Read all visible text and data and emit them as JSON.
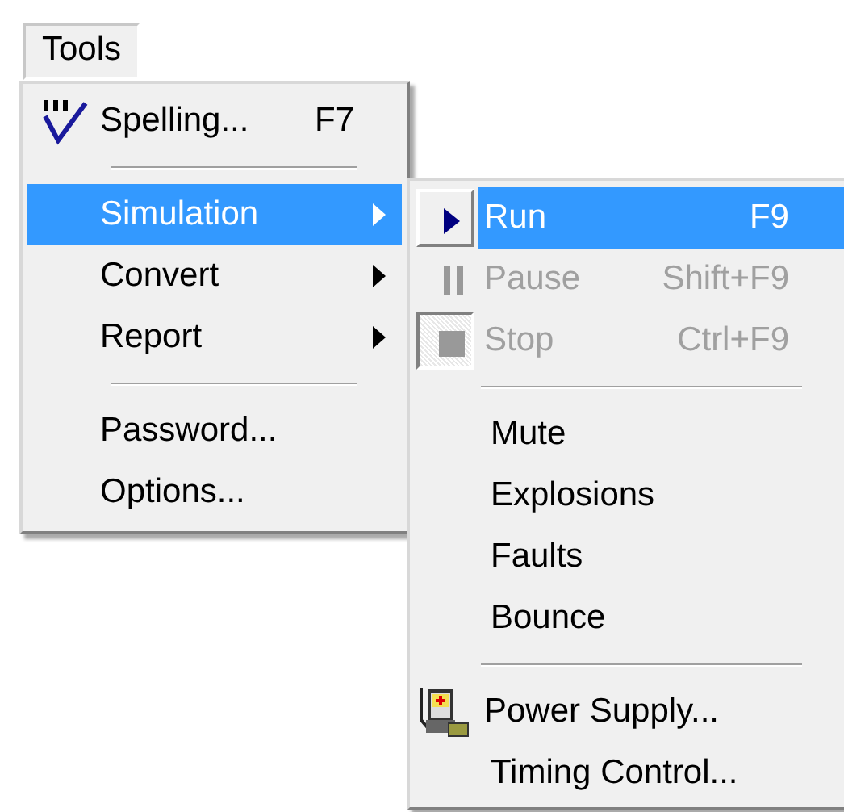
{
  "menubar": [
    {
      "label": "Tools",
      "selected": true
    }
  ],
  "menu": {
    "items": [
      {
        "kind": "item",
        "label": "Spelling...",
        "shortcut": "F7",
        "selected": false
      },
      {
        "kind": "separator"
      },
      {
        "kind": "submenu",
        "label": "Simulation",
        "selected": true
      },
      {
        "kind": "submenu",
        "label": "Convert",
        "selected": false
      },
      {
        "kind": "submenu",
        "label": "Report",
        "selected": false
      },
      {
        "kind": "separator"
      },
      {
        "kind": "item",
        "label": "Password...",
        "selected": false
      },
      {
        "kind": "item",
        "label": "Options...",
        "selected": false
      }
    ]
  },
  "submenu": {
    "items": [
      {
        "kind": "item",
        "label": "Run",
        "shortcut": "F9",
        "selected": true,
        "disabled": false,
        "checked": false
      },
      {
        "kind": "item",
        "label": "Pause",
        "shortcut": "Shift+F9",
        "selected": false,
        "disabled": true,
        "checked": false
      },
      {
        "kind": "item",
        "label": "Stop",
        "shortcut": "Ctrl+F9",
        "selected": false,
        "disabled": true,
        "checked": true
      },
      {
        "kind": "separator"
      },
      {
        "kind": "item",
        "label": "Mute",
        "selected": false,
        "disabled": false,
        "checked": false
      },
      {
        "kind": "item",
        "label": "Explosions",
        "selected": false,
        "disabled": false,
        "checked": false
      },
      {
        "kind": "item",
        "label": "Faults",
        "selected": false,
        "disabled": false,
        "checked": false
      },
      {
        "kind": "item",
        "label": "Bounce",
        "selected": false,
        "disabled": false,
        "checked": false
      },
      {
        "kind": "separator"
      },
      {
        "kind": "item",
        "label": "Power Supply...",
        "selected": false,
        "disabled": false,
        "checked": false
      },
      {
        "kind": "item",
        "label": "Timing Control...",
        "selected": false,
        "disabled": false,
        "checked": false
      }
    ]
  }
}
